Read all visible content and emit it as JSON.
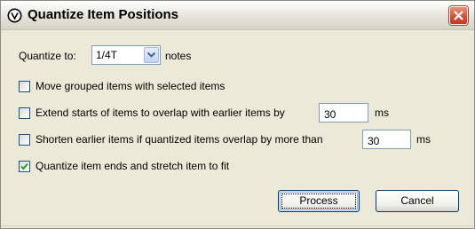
{
  "window": {
    "title": "Quantize Item Positions",
    "icon": "reaper-icon",
    "close_icon": "close-icon"
  },
  "quantize": {
    "label": "Quantize to:",
    "selected_value": "1/4T",
    "suffix": "notes"
  },
  "options": {
    "move_grouped": {
      "label": "Move grouped items with selected items",
      "checked": false
    },
    "extend_starts": {
      "label": "Extend starts of items to overlap with earlier items by",
      "value": "30",
      "unit": "ms",
      "checked": false
    },
    "shorten_earlier": {
      "label": "Shorten earlier items if quantized items overlap by more than",
      "value": "30",
      "unit": "ms",
      "checked": false
    },
    "quantize_ends": {
      "label": "Quantize item ends and stretch item to fit",
      "checked": true
    }
  },
  "buttons": {
    "process": "Process",
    "cancel": "Cancel"
  },
  "colors": {
    "dialog_bg": "#ece9d8",
    "close_button": "#d1533a",
    "checkbox_border": "#1c5180",
    "check_mark": "#21a121"
  }
}
